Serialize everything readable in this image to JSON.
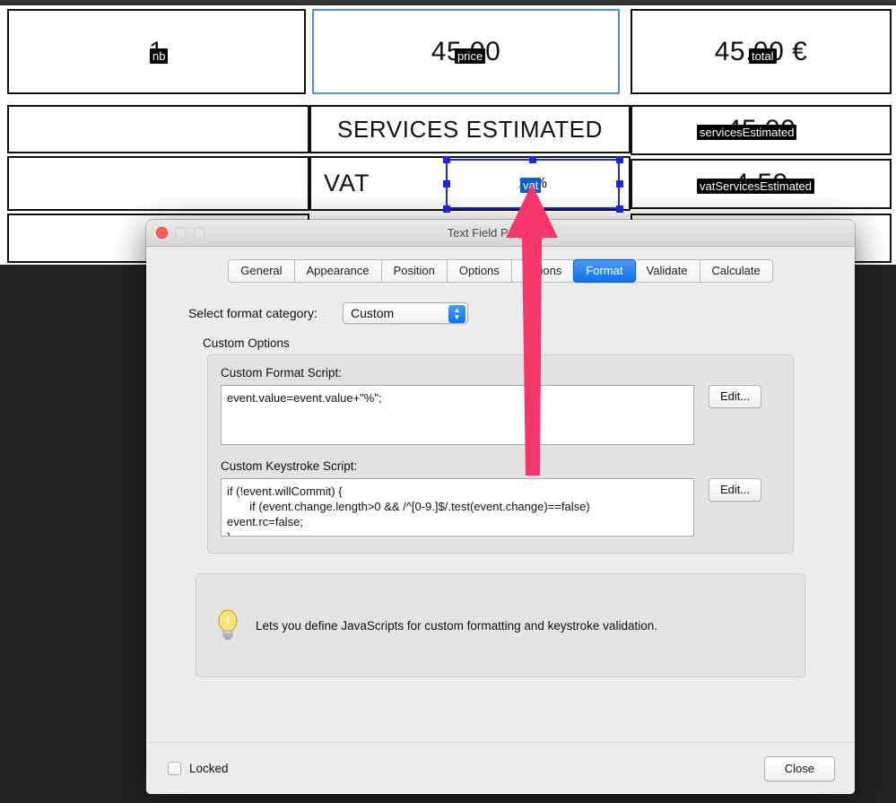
{
  "document": {
    "cells": [
      {
        "id": "nb-cell",
        "text": "1",
        "badge": "nb",
        "badge_style": "black"
      },
      {
        "id": "price-cell",
        "text": "45.00",
        "badge": "price",
        "badge_style": "black"
      },
      {
        "id": "total-cell",
        "text": "45.00 €",
        "badge": "total",
        "badge_style": "black"
      },
      {
        "id": "services-label",
        "text": "SERVICES ESTIMATED",
        "badge": "",
        "badge_style": ""
      },
      {
        "id": "services-cell",
        "text": "45.00",
        "badge": "servicesEstimated",
        "badge_style": "black"
      },
      {
        "id": "vat-label",
        "text": "VAT",
        "badge": "",
        "badge_style": ""
      },
      {
        "id": "vat-cell",
        "text": "10%",
        "badge": "vat",
        "badge_style": "blue"
      },
      {
        "id": "vatserv-cell",
        "text": "4.50",
        "badge": "vatServicesEstimated",
        "badge_style": "black"
      }
    ]
  },
  "dialog": {
    "title": "Text Field Properties",
    "tabs": [
      {
        "label": "General",
        "active": false
      },
      {
        "label": "Appearance",
        "active": false
      },
      {
        "label": "Position",
        "active": false
      },
      {
        "label": "Options",
        "active": false
      },
      {
        "label": "Actions",
        "active": false
      },
      {
        "label": "Format",
        "active": true
      },
      {
        "label": "Validate",
        "active": false
      },
      {
        "label": "Calculate",
        "active": false
      }
    ],
    "format_category_label": "Select format category:",
    "format_category_value": "Custom",
    "custom_options_title": "Custom Options",
    "custom_format_label": "Custom Format Script:",
    "custom_format_script": "event.value=event.value+\"%\";",
    "custom_keystroke_label": "Custom Keystroke Script:",
    "custom_keystroke_script": "if (!event.willCommit) {\n       if (event.change.length>0 && /^[0-9.]$/.test(event.change)==false)\nevent.rc=false;\n}",
    "edit_button_format": "Edit...",
    "edit_button_keystroke": "Edit...",
    "hint_text": "Lets you define JavaScripts for custom formatting and keystroke validation.",
    "locked_label": "Locked",
    "locked_checked": false,
    "close_label": "Close"
  },
  "annotation": {
    "arrow_color": "#F4366B"
  },
  "colors": {
    "accent_blue": "#0b72f0",
    "selection_blue": "#1a27e8",
    "badge_black": "#000000",
    "badge_blue": "#0b5fd6",
    "backdrop": "#242424"
  }
}
